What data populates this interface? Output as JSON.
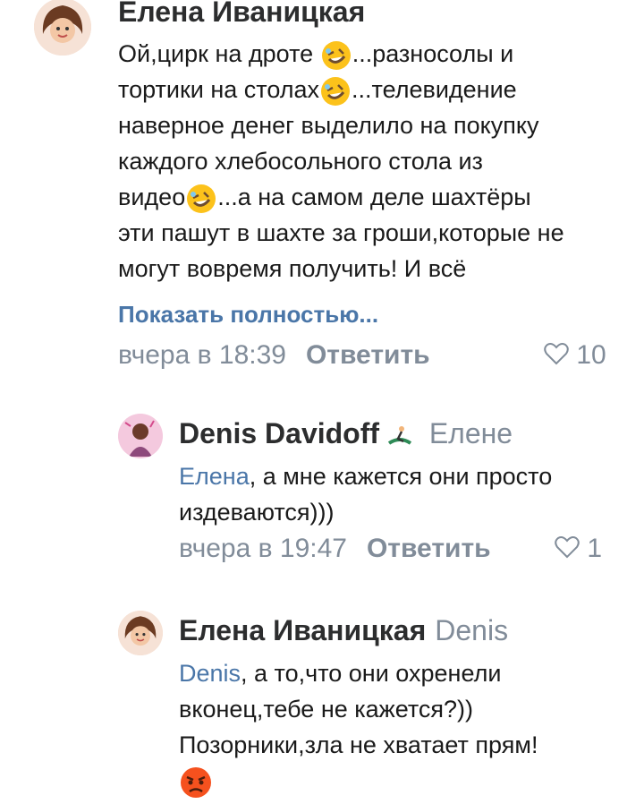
{
  "comments": [
    {
      "author": "Елена Иваницкая",
      "reply_to": "",
      "lines": [
        "Ой,цирк на дроте",
        "...разносолы и",
        "тортики на столах",
        "...телевидение",
        "наверное денег выделило на покупку",
        "каждого хлебосольного стола из",
        "видео",
        "...а на самом деле шахтёры",
        "эти пашут в шахте за гроши,которые не",
        "могут вовремя получить! И всё"
      ],
      "show_more": "Показать полностью...",
      "time": "вчера в 18:39",
      "reply": "Ответить",
      "likes": "10"
    },
    {
      "author": "Denis Davidoff",
      "reply_to": "Елене",
      "mention": "Елена",
      "lines": [
        ", а мне кажется они просто",
        "издеваются)))"
      ],
      "time": "вчера в 19:47",
      "reply": "Ответить",
      "likes": "1"
    },
    {
      "author": "Елена Иваницкая",
      "reply_to": "Denis",
      "mention": "Denis",
      "lines": [
        ", а то,что они охренели",
        "вконец,тебе не кажется?))",
        "Позорники,зла не хватает прям!"
      ]
    }
  ],
  "icons": {
    "laugh": "rolling-on-floor-laughing-emoji",
    "angry": "angry-face-emoji",
    "heart": "heart-outline-icon",
    "surf": "surfer-emoji"
  },
  "colors": {
    "link": "#4a76a8",
    "secondary": "#818c99"
  }
}
